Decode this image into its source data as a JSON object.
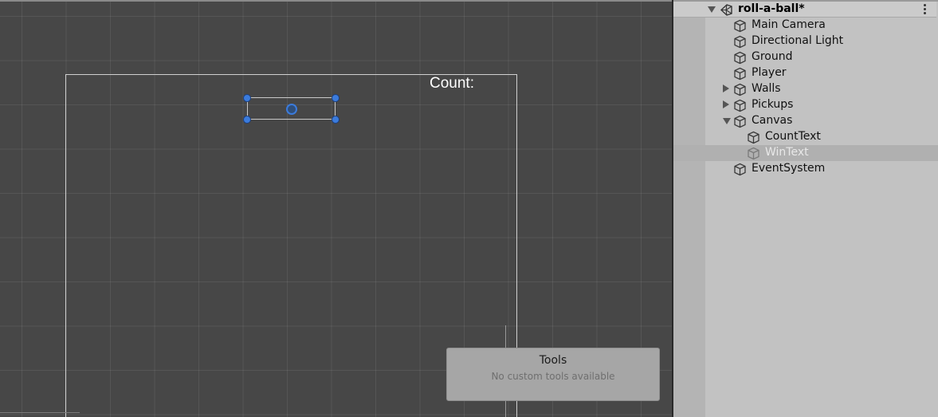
{
  "scene_view": {
    "canvas_text": "Count:",
    "tools_panel": {
      "title": "Tools",
      "subtitle": "No custom tools available"
    }
  },
  "hierarchy": {
    "scene_name": "roll-a-ball*",
    "items": [
      {
        "label": "Main Camera",
        "icon": "gameobject-cube-icon",
        "expand": "none",
        "depth": 1,
        "selected": false
      },
      {
        "label": "Directional Light",
        "icon": "gameobject-cube-icon",
        "expand": "none",
        "depth": 1,
        "selected": false
      },
      {
        "label": "Ground",
        "icon": "gameobject-cube-icon",
        "expand": "none",
        "depth": 1,
        "selected": false
      },
      {
        "label": "Player",
        "icon": "gameobject-cube-icon",
        "expand": "none",
        "depth": 1,
        "selected": false
      },
      {
        "label": "Walls",
        "icon": "gameobject-cube-icon",
        "expand": "collapsed",
        "depth": 1,
        "selected": false
      },
      {
        "label": "Pickups",
        "icon": "gameobject-cube-icon",
        "expand": "collapsed",
        "depth": 1,
        "selected": false
      },
      {
        "label": "Canvas",
        "icon": "gameobject-cube-icon",
        "expand": "expanded",
        "depth": 1,
        "selected": false
      },
      {
        "label": "CountText",
        "icon": "gameobject-cube-icon",
        "expand": "none",
        "depth": 2,
        "selected": false
      },
      {
        "label": "WinText",
        "icon": "gameobject-cube-icon",
        "expand": "none",
        "depth": 2,
        "selected": true
      },
      {
        "label": "EventSystem",
        "icon": "gameobject-cube-icon",
        "expand": "none",
        "depth": 1,
        "selected": false
      }
    ]
  },
  "colors": {
    "scene_background": "#474747",
    "handle_blue": "#3b7bdc",
    "hierarchy_background": "#c2c2c2",
    "selection_background": "#b0b0b0"
  }
}
